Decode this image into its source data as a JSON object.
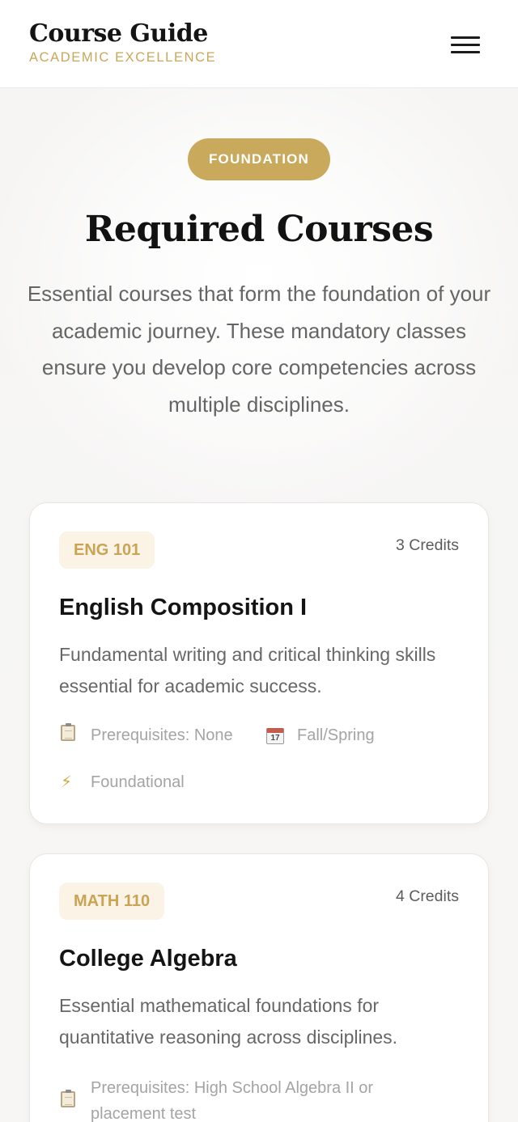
{
  "header": {
    "title": "Course Guide",
    "subtitle": "ACADEMIC EXCELLENCE",
    "menu_icon": "hamburger-menu-icon"
  },
  "hero": {
    "badge": "FOUNDATION",
    "title": "Required Courses",
    "description": "Essential courses that form the foundation of your academic journey. These mandatory classes ensure you develop core competencies across multiple disciplines."
  },
  "courses": [
    {
      "code": "ENG 101",
      "credits": "3 Credits",
      "title": "English Composition I",
      "description": "Fundamental writing and critical thinking skills essential for academic success.",
      "prerequisites": "Prerequisites: None",
      "term": "Fall/Spring",
      "type": "Foundational",
      "calendar_day": "17"
    },
    {
      "code": "MATH 110",
      "credits": "4 Credits",
      "title": "College Algebra",
      "description": "Essential mathematical foundations for quantitative reasoning across disciplines.",
      "prerequisites_line1": "Prerequisites: High School Algebra II or",
      "prerequisites_line2": "placement test"
    }
  ],
  "colors": {
    "accent_gold": "#c9a95c",
    "badge_bg": "#faf3e6",
    "text_dark": "#141414",
    "text_muted": "#676767"
  }
}
